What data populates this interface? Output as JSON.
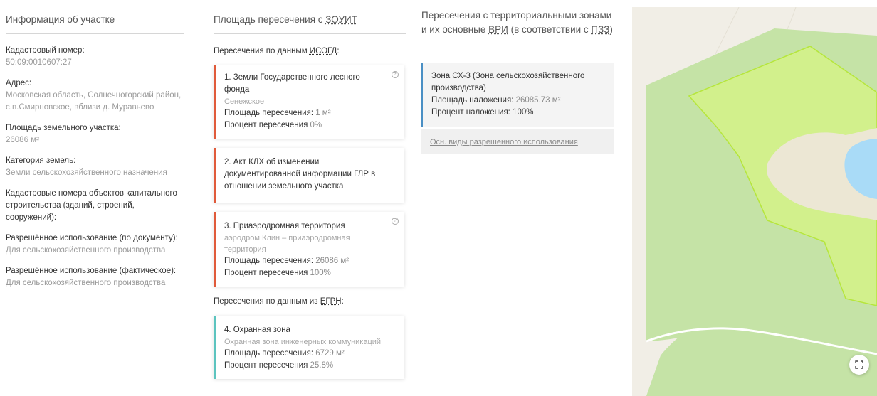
{
  "parcel": {
    "title": "Информация об участке",
    "fields": [
      {
        "label": "Кадастровый номер:",
        "value": "50:09:0010607:27"
      },
      {
        "label": "Адрес:",
        "value": "Московская область, Солнечногорский район, с.п.Смирновское, вблизи д. Муравьево"
      },
      {
        "label": "Площадь земельного участка:",
        "value": "26086 м²"
      },
      {
        "label": "Категория земель:",
        "value": "Земли сельскохозяйственного назначения"
      },
      {
        "label": "Кадастровые номера объектов капитального строительства (зданий, строений, сооружений):",
        "value": ""
      },
      {
        "label": "Разрешённое использование (по документу):",
        "value": "Для сельскохозяйственного производства"
      },
      {
        "label": "Разрешённое использование (фактическое):",
        "value": "Для сельскохозяйственного производства"
      }
    ]
  },
  "zouit": {
    "title_prefix": "Площадь пересечения с ",
    "title_abbr": "ЗОУИТ",
    "isogd_prefix": "Пересечения по данным ",
    "isogd_abbr": "ИСОГД",
    "isogd_suffix": ":",
    "egrn_prefix": "Пересечения по данным из ",
    "egrn_abbr": "ЕГРН",
    "egrn_suffix": ":",
    "area_label": "Площадь пересечения: ",
    "percent_label": "Процент пересечения ",
    "isogd_items": [
      {
        "title": "1. Земли Государственного лесного фонда",
        "subtitle": "Сенежское",
        "area": "1 м²",
        "percent": "0%"
      },
      {
        "title": "2. Акт КЛХ об изменении документированной информации ГЛР в отношении земельного участка"
      },
      {
        "title": "3. Приаэродромная территория",
        "subtitle": "аэродром Клин – приаэродромная территория",
        "area": "26086 м²",
        "percent": "100%"
      }
    ],
    "egrn_items": [
      {
        "title": "4. Охранная зона",
        "subtitle": "Охранная зона инженерных коммуникаций",
        "area": "6729 м²",
        "percent": "25.8%"
      }
    ]
  },
  "zones": {
    "title_prefix": "Пересечения с территориальными зонами и их основные ",
    "title_abbr1": "ВРИ",
    "title_mid": " (в соответствии с ",
    "title_abbr2": "ПЗЗ",
    "title_suffix": ")",
    "zone_name": "Зона СХ-3 (Зона сельскохозяйственного производства)",
    "overlay_label": "Площадь наложения: ",
    "overlay_area": "26085.73 м²",
    "overlay_percent_label": "Процент наложения: ",
    "overlay_percent": "100%",
    "link": "Осн. виды разрешенного использования"
  },
  "map": {
    "colors": {
      "base": "#f1eee6",
      "parcel_fill": "#d2f08c",
      "parcel_stroke": "#b6e63c",
      "forest": "#c5e3a6",
      "water": "#a9dbf7",
      "sand": "#ece7d4",
      "road": "#ffffff"
    },
    "fullscreen_icon": "fullscreen-icon"
  },
  "help_icon": "question-icon",
  "help_glyph": "?"
}
